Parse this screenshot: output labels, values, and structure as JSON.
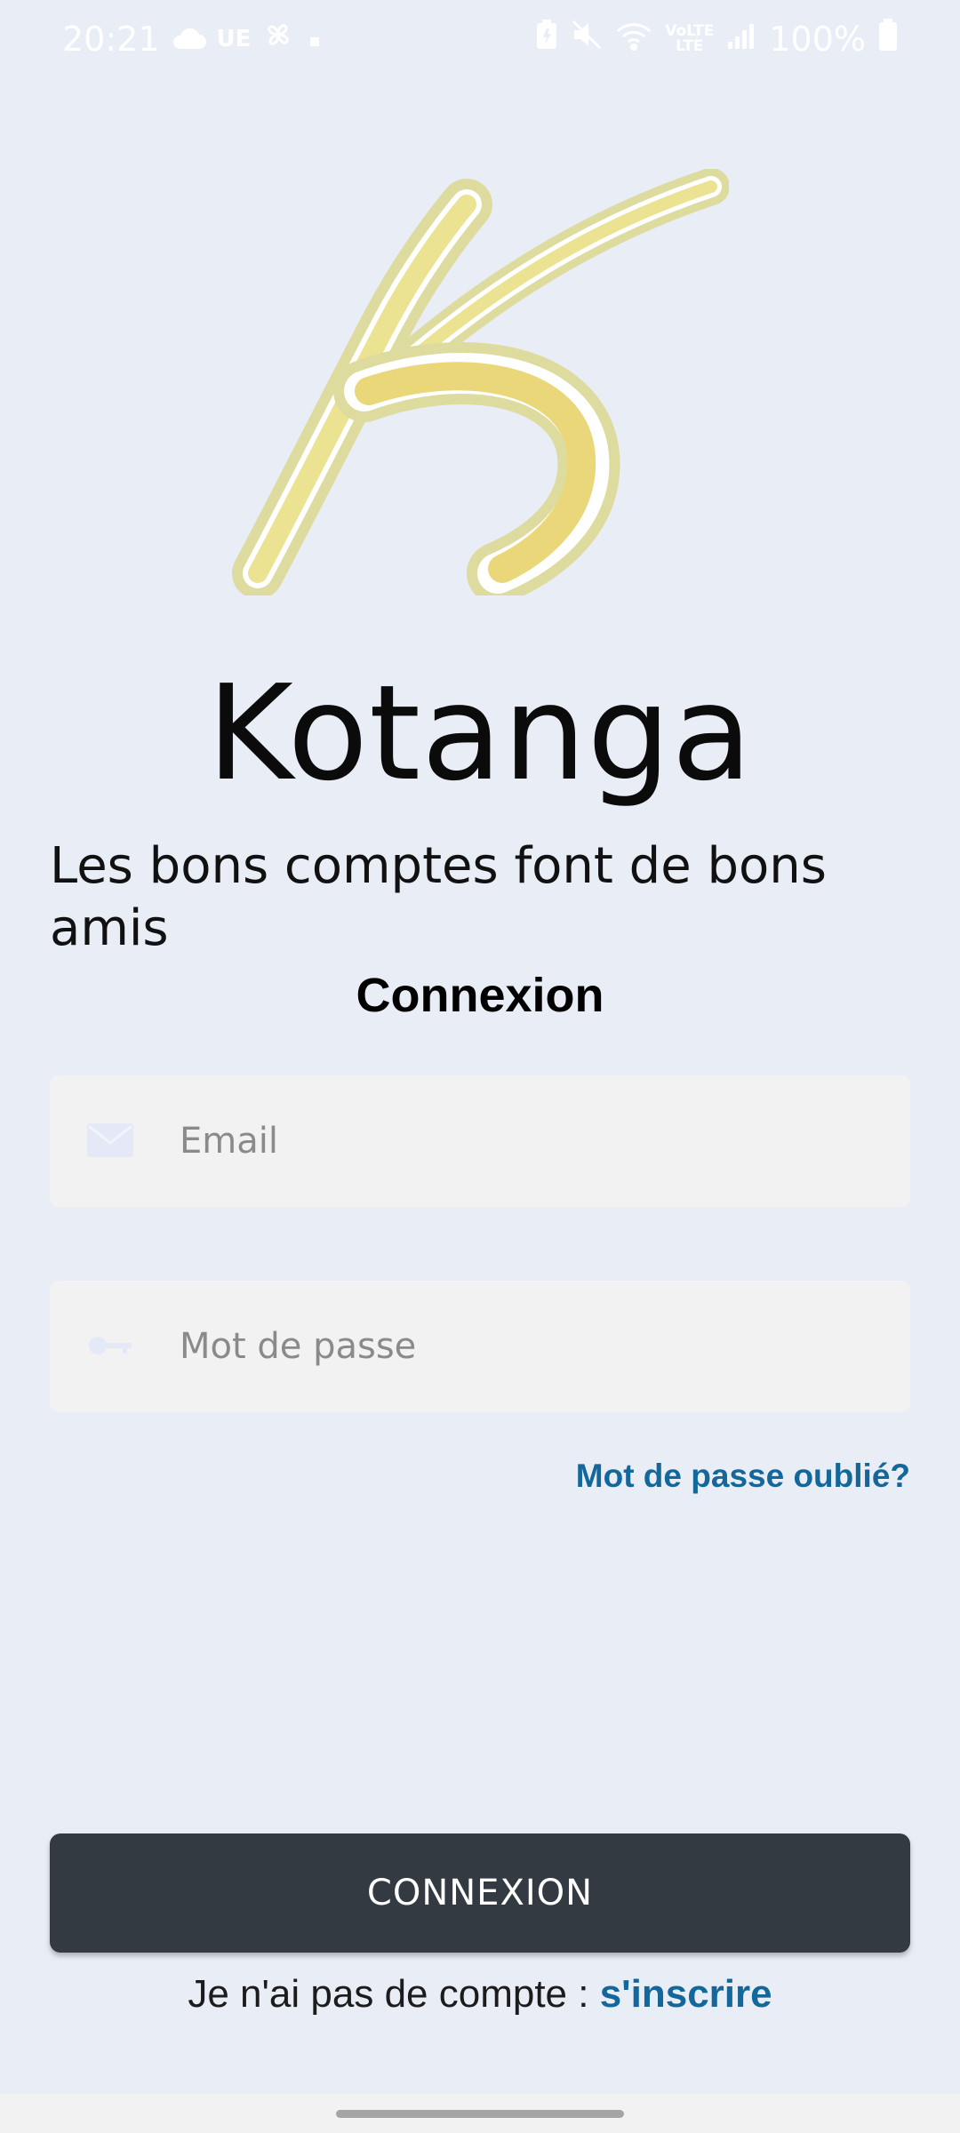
{
  "status_bar": {
    "time": "20:21",
    "carrier_badge": "UE",
    "battery": "100%",
    "volte": "LTE"
  },
  "app": {
    "title": "Kotanga",
    "tagline": "Les bons comptes font de bons amis",
    "logo_color": "#e8e08a"
  },
  "login": {
    "section_title": "Connexion",
    "email_placeholder": "Email",
    "email_value": "",
    "password_placeholder": "Mot de passe",
    "password_value": "",
    "forgot_label": "Mot de passe oublié?",
    "submit_label": "CONNEXION",
    "signup_prompt": "Je n'ai pas de compte : ",
    "signup_link": "s'inscrire"
  },
  "colors": {
    "background": "#e9edf6",
    "field_background": "#f2f2f2",
    "button": "#333a42",
    "link": "#14679a"
  }
}
